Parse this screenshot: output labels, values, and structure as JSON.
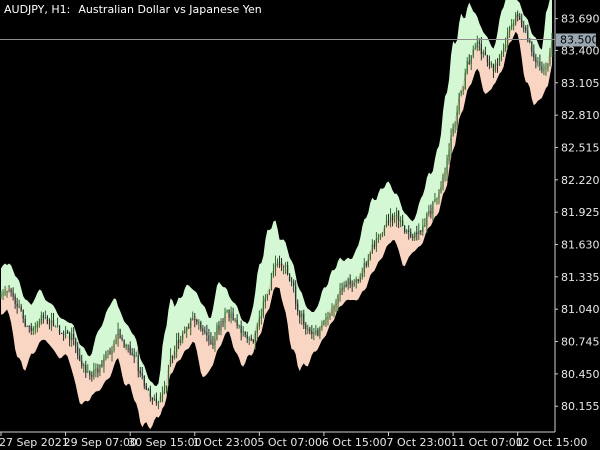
{
  "chart_header": {
    "symbol_label": "AUDJPY, H1:",
    "instrument_name": "Australian Dollar vs Japanese Yen"
  },
  "current_price": {
    "label": "83.500",
    "value": 83.5
  },
  "colors": {
    "background": "#000000",
    "upper_band": "#d4f7d4",
    "lower_band": "#f9d6c4",
    "candle_up": "#2e6b2e",
    "candle_down": "#2b2b2b",
    "axis_line": "#cfcfcf",
    "axis_text": "#e8e8e8",
    "price_line": "#8c8c8c",
    "price_tag_bg": "#9aa6b2"
  },
  "chart_data": {
    "type": "candlestick-with-bands",
    "title": "AUDJPY, H1: Australian Dollar vs Japanese Yen",
    "ylim": [
      79.92,
      83.86
    ],
    "y_tick_labels": [
      "83.690",
      "83.400",
      "83.105",
      "82.810",
      "82.515",
      "82.220",
      "81.925",
      "81.630",
      "81.335",
      "81.040",
      "80.745",
      "80.450",
      "80.155"
    ],
    "y_tick_values": [
      83.69,
      83.4,
      83.105,
      82.81,
      82.515,
      82.22,
      81.925,
      81.63,
      81.335,
      81.04,
      80.745,
      80.45,
      80.155
    ],
    "x_tick_labels": [
      "27 Sep 2021",
      "29 Sep 07:00",
      "30 Sep 15:00",
      "1 Oct 23:00",
      "5 Oct 07:00",
      "6 Oct 15:00",
      "7 Oct 23:00",
      "11 Oct 07:00",
      "12 Oct 15:00"
    ],
    "x_tick_positions": [
      0,
      32,
      64,
      96,
      128,
      160,
      192,
      224,
      256
    ],
    "bar_count": 274,
    "mid_anchors": [
      [
        0,
        81.17
      ],
      [
        4,
        81.25
      ],
      [
        8,
        81.1
      ],
      [
        12,
        80.9
      ],
      [
        16,
        80.85
      ],
      [
        20,
        80.95
      ],
      [
        25,
        80.93
      ],
      [
        30,
        80.82
      ],
      [
        35,
        80.78
      ],
      [
        40,
        80.55
      ],
      [
        44,
        80.43
      ],
      [
        48,
        80.5
      ],
      [
        53,
        80.63
      ],
      [
        58,
        80.82
      ],
      [
        62,
        80.7
      ],
      [
        66,
        80.62
      ],
      [
        70,
        80.4
      ],
      [
        74,
        80.25
      ],
      [
        78,
        80.18
      ],
      [
        81,
        80.3
      ],
      [
        84,
        80.6
      ],
      [
        88,
        80.75
      ],
      [
        92,
        80.88
      ],
      [
        96,
        80.98
      ],
      [
        100,
        80.85
      ],
      [
        104,
        80.72
      ],
      [
        108,
        80.88
      ],
      [
        112,
        81.0
      ],
      [
        116,
        80.95
      ],
      [
        120,
        80.8
      ],
      [
        124,
        80.75
      ],
      [
        128,
        80.95
      ],
      [
        132,
        81.2
      ],
      [
        136,
        81.45
      ],
      [
        140,
        81.45
      ],
      [
        144,
        81.25
      ],
      [
        148,
        81.0
      ],
      [
        152,
        80.85
      ],
      [
        156,
        80.82
      ],
      [
        160,
        80.92
      ],
      [
        164,
        81.05
      ],
      [
        168,
        81.2
      ],
      [
        172,
        81.28
      ],
      [
        176,
        81.3
      ],
      [
        180,
        81.42
      ],
      [
        184,
        81.6
      ],
      [
        188,
        81.72
      ],
      [
        192,
        81.85
      ],
      [
        196,
        81.9
      ],
      [
        200,
        81.75
      ],
      [
        204,
        81.7
      ],
      [
        208,
        81.75
      ],
      [
        212,
        81.92
      ],
      [
        216,
        82.05
      ],
      [
        220,
        82.3
      ],
      [
        224,
        82.7
      ],
      [
        228,
        83.05
      ],
      [
        232,
        83.3
      ],
      [
        236,
        83.45
      ],
      [
        240,
        83.35
      ],
      [
        244,
        83.25
      ],
      [
        248,
        83.35
      ],
      [
        252,
        83.6
      ],
      [
        256,
        83.72
      ],
      [
        260,
        83.55
      ],
      [
        264,
        83.35
      ],
      [
        268,
        83.2
      ],
      [
        271,
        83.3
      ],
      [
        273,
        83.5
      ]
    ],
    "band_half_width_mean": 0.12,
    "band_half_width_swing": 0.32
  }
}
